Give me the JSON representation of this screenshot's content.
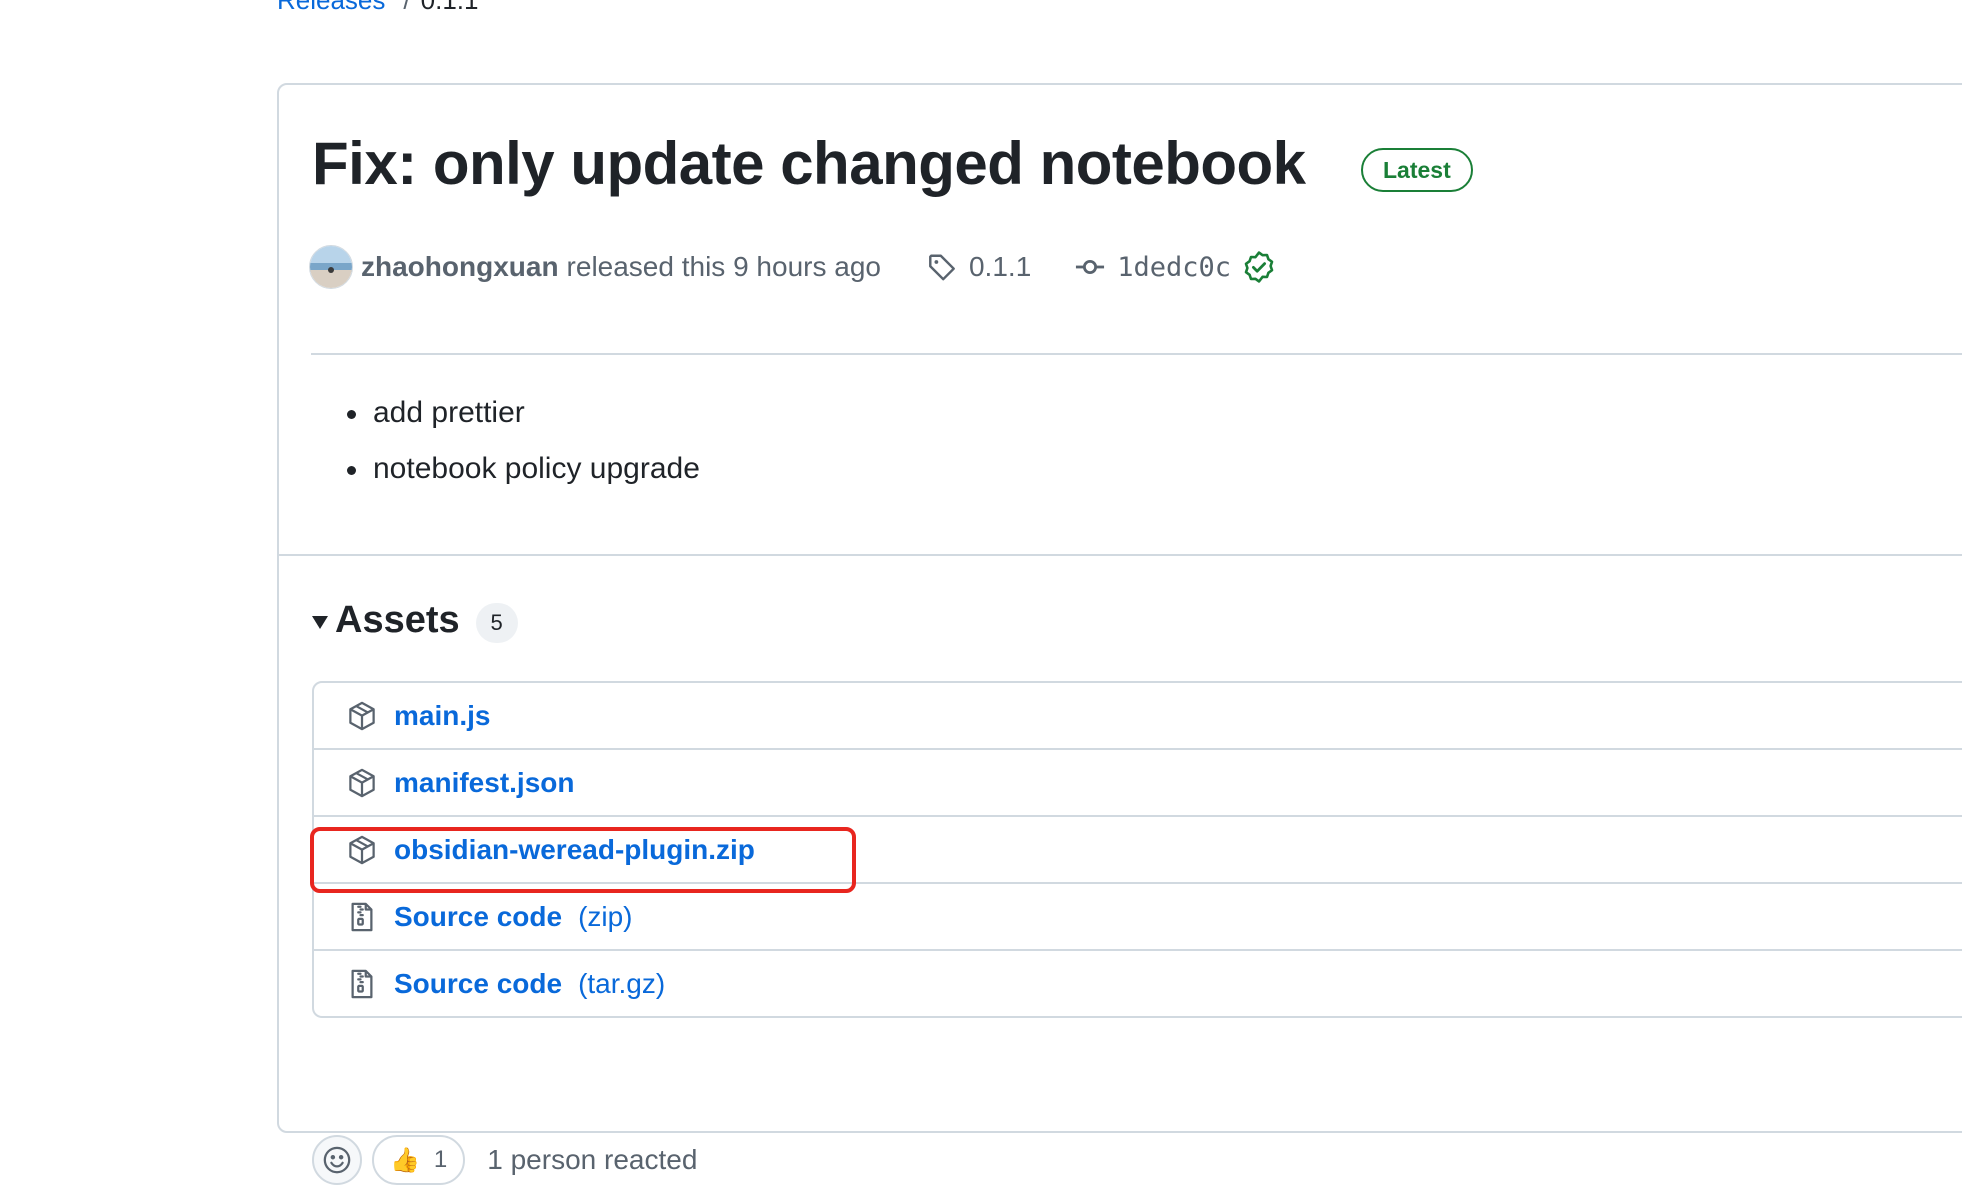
{
  "breadcrumb": {
    "parent": "Releases",
    "separator": "/",
    "current": "0.1.1"
  },
  "release": {
    "title": "Fix: only update changed notebook",
    "badge": "Latest",
    "author": "zhaohongxuan",
    "released_text": "released this 9 hours ago",
    "tag": "0.1.1",
    "commit": "1dedc0c",
    "notes": [
      "add prettier",
      "notebook policy upgrade"
    ]
  },
  "assets": {
    "title": "Assets",
    "count": "5",
    "items": [
      {
        "name": "main.js",
        "suffix": "",
        "icon": "package-icon"
      },
      {
        "name": "manifest.json",
        "suffix": "",
        "icon": "package-icon"
      },
      {
        "name": "obsidian-weread-plugin.zip",
        "suffix": "",
        "icon": "package-icon"
      },
      {
        "name": "Source code",
        "suffix": "(zip)",
        "icon": "file-zip-icon"
      },
      {
        "name": "Source code",
        "suffix": "(tar.gz)",
        "icon": "file-zip-icon"
      }
    ]
  },
  "reactions": {
    "emoji": "👍",
    "count": "1",
    "summary": "1 person reacted"
  },
  "colors": {
    "link": "#0969da",
    "latest_badge": "#1a7f37",
    "highlight": "#e8261f",
    "border": "#d1d9e0",
    "muted_text": "#59636e"
  }
}
